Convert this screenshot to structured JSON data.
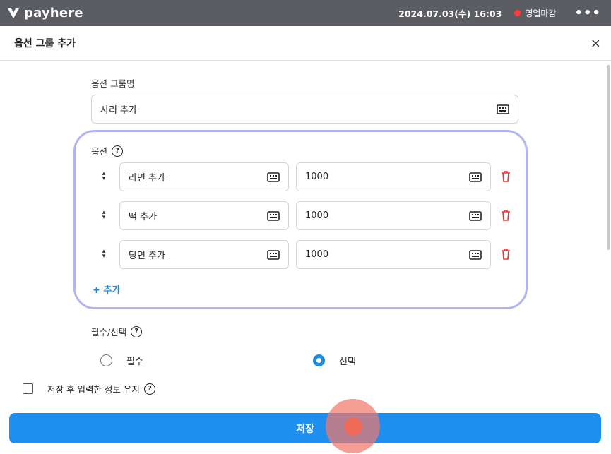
{
  "topbar": {
    "brand": "payhere",
    "datetime": "2024.07.03(수) 16:03",
    "status": "영업마감",
    "status_color": "#ff3b3b",
    "more": "•••"
  },
  "header": {
    "title": "옵션 그룹 추가",
    "close": "×"
  },
  "group_name": {
    "label": "옵션 그룹명",
    "value": "사리 추가",
    "keyboard_icon": "keyboard-icon"
  },
  "options": {
    "label": "옵션",
    "help_icon": "?",
    "rows": [
      {
        "name": "라면 추가",
        "price": "1000"
      },
      {
        "name": "떡 추가",
        "price": "1000"
      },
      {
        "name": "당면 추가",
        "price": "1000"
      }
    ],
    "add_label": "+ 추가"
  },
  "requirement": {
    "label": "필수/선택",
    "help_icon": "?",
    "choices": [
      {
        "label": "필수",
        "selected": false
      },
      {
        "label": "선택",
        "selected": true
      }
    ]
  },
  "keep_info": {
    "label": "저장 후 입력한 정보 유지",
    "help_icon": "?",
    "checked": false
  },
  "save_button": {
    "label": "저장",
    "color": "#1e8fee"
  },
  "accent_color": "#1d8ce0",
  "highlight_border_color": "#b3b5f0"
}
